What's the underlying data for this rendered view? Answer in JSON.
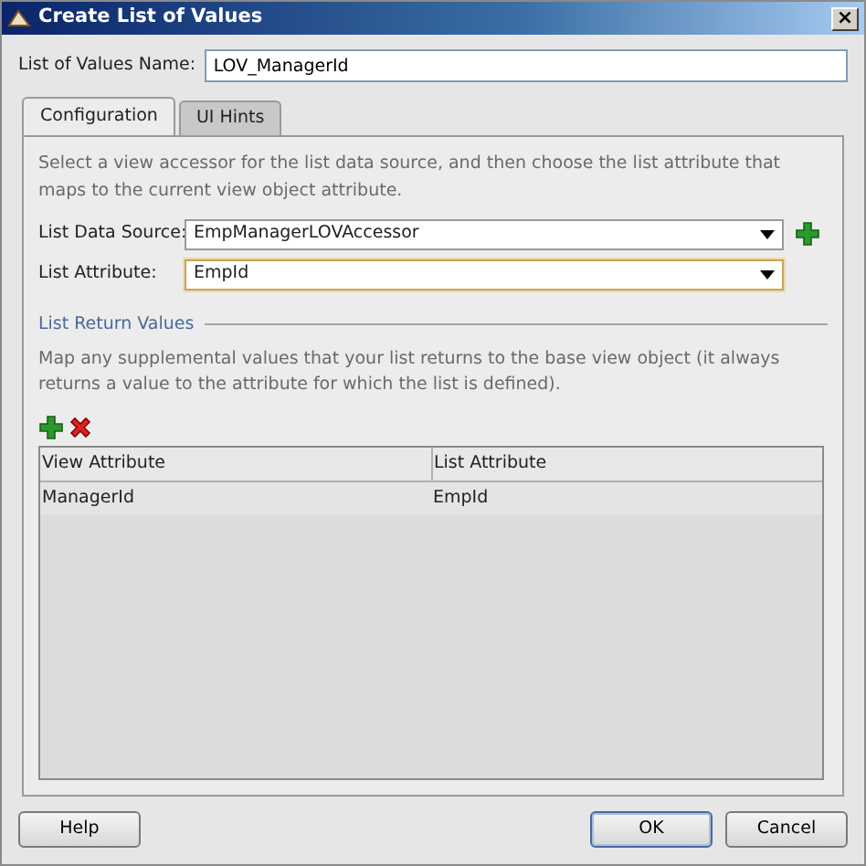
{
  "window": {
    "title": "Create List of Values",
    "close": "×"
  },
  "name_field": {
    "label": "List of Values Name:",
    "value": "LOV_ManagerId"
  },
  "tabs": [
    {
      "label": "Configuration",
      "selected": true
    },
    {
      "label": "UI Hints",
      "selected": false
    }
  ],
  "intro": "Select a view accessor for the list data source, and then choose the list attribute that maps to the current view object attribute.",
  "fields": [
    {
      "label": "List Data Source:",
      "value": "EmpManagerLOVAccessor",
      "focused": false,
      "add_button": true
    },
    {
      "label": "List Attribute:",
      "value": "EmpId",
      "focused": true,
      "add_button": false
    }
  ],
  "return_values": {
    "heading": "List Return Values",
    "description": "Map any supplemental values that your list returns to the base view object (it always returns a value to the attribute for which the list is defined).",
    "table": {
      "columns": [
        "View Attribute",
        "List Attribute"
      ],
      "rows": [
        [
          "ManagerId",
          "EmpId"
        ]
      ]
    }
  },
  "buttons": [
    {
      "label": "Help",
      "kind": "help",
      "default": false
    },
    {
      "label": "OK",
      "kind": "ok",
      "default": true
    },
    {
      "label": "Cancel",
      "kind": "cancel",
      "default": false
    }
  ]
}
